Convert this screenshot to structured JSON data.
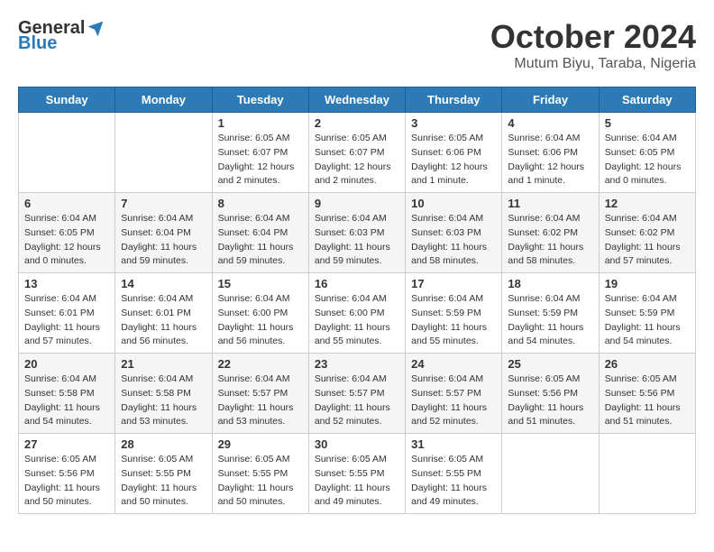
{
  "logo": {
    "general": "General",
    "blue": "Blue"
  },
  "title": "October 2024",
  "subtitle": "Mutum Biyu, Taraba, Nigeria",
  "days_of_week": [
    "Sunday",
    "Monday",
    "Tuesday",
    "Wednesday",
    "Thursday",
    "Friday",
    "Saturday"
  ],
  "weeks": [
    [
      {
        "day": "",
        "info": ""
      },
      {
        "day": "",
        "info": ""
      },
      {
        "day": "1",
        "info": "Sunrise: 6:05 AM\nSunset: 6:07 PM\nDaylight: 12 hours and 2 minutes."
      },
      {
        "day": "2",
        "info": "Sunrise: 6:05 AM\nSunset: 6:07 PM\nDaylight: 12 hours and 2 minutes."
      },
      {
        "day": "3",
        "info": "Sunrise: 6:05 AM\nSunset: 6:06 PM\nDaylight: 12 hours and 1 minute."
      },
      {
        "day": "4",
        "info": "Sunrise: 6:04 AM\nSunset: 6:06 PM\nDaylight: 12 hours and 1 minute."
      },
      {
        "day": "5",
        "info": "Sunrise: 6:04 AM\nSunset: 6:05 PM\nDaylight: 12 hours and 0 minutes."
      }
    ],
    [
      {
        "day": "6",
        "info": "Sunrise: 6:04 AM\nSunset: 6:05 PM\nDaylight: 12 hours and 0 minutes."
      },
      {
        "day": "7",
        "info": "Sunrise: 6:04 AM\nSunset: 6:04 PM\nDaylight: 11 hours and 59 minutes."
      },
      {
        "day": "8",
        "info": "Sunrise: 6:04 AM\nSunset: 6:04 PM\nDaylight: 11 hours and 59 minutes."
      },
      {
        "day": "9",
        "info": "Sunrise: 6:04 AM\nSunset: 6:03 PM\nDaylight: 11 hours and 59 minutes."
      },
      {
        "day": "10",
        "info": "Sunrise: 6:04 AM\nSunset: 6:03 PM\nDaylight: 11 hours and 58 minutes."
      },
      {
        "day": "11",
        "info": "Sunrise: 6:04 AM\nSunset: 6:02 PM\nDaylight: 11 hours and 58 minutes."
      },
      {
        "day": "12",
        "info": "Sunrise: 6:04 AM\nSunset: 6:02 PM\nDaylight: 11 hours and 57 minutes."
      }
    ],
    [
      {
        "day": "13",
        "info": "Sunrise: 6:04 AM\nSunset: 6:01 PM\nDaylight: 11 hours and 57 minutes."
      },
      {
        "day": "14",
        "info": "Sunrise: 6:04 AM\nSunset: 6:01 PM\nDaylight: 11 hours and 56 minutes."
      },
      {
        "day": "15",
        "info": "Sunrise: 6:04 AM\nSunset: 6:00 PM\nDaylight: 11 hours and 56 minutes."
      },
      {
        "day": "16",
        "info": "Sunrise: 6:04 AM\nSunset: 6:00 PM\nDaylight: 11 hours and 55 minutes."
      },
      {
        "day": "17",
        "info": "Sunrise: 6:04 AM\nSunset: 5:59 PM\nDaylight: 11 hours and 55 minutes."
      },
      {
        "day": "18",
        "info": "Sunrise: 6:04 AM\nSunset: 5:59 PM\nDaylight: 11 hours and 54 minutes."
      },
      {
        "day": "19",
        "info": "Sunrise: 6:04 AM\nSunset: 5:59 PM\nDaylight: 11 hours and 54 minutes."
      }
    ],
    [
      {
        "day": "20",
        "info": "Sunrise: 6:04 AM\nSunset: 5:58 PM\nDaylight: 11 hours and 54 minutes."
      },
      {
        "day": "21",
        "info": "Sunrise: 6:04 AM\nSunset: 5:58 PM\nDaylight: 11 hours and 53 minutes."
      },
      {
        "day": "22",
        "info": "Sunrise: 6:04 AM\nSunset: 5:57 PM\nDaylight: 11 hours and 53 minutes."
      },
      {
        "day": "23",
        "info": "Sunrise: 6:04 AM\nSunset: 5:57 PM\nDaylight: 11 hours and 52 minutes."
      },
      {
        "day": "24",
        "info": "Sunrise: 6:04 AM\nSunset: 5:57 PM\nDaylight: 11 hours and 52 minutes."
      },
      {
        "day": "25",
        "info": "Sunrise: 6:05 AM\nSunset: 5:56 PM\nDaylight: 11 hours and 51 minutes."
      },
      {
        "day": "26",
        "info": "Sunrise: 6:05 AM\nSunset: 5:56 PM\nDaylight: 11 hours and 51 minutes."
      }
    ],
    [
      {
        "day": "27",
        "info": "Sunrise: 6:05 AM\nSunset: 5:56 PM\nDaylight: 11 hours and 50 minutes."
      },
      {
        "day": "28",
        "info": "Sunrise: 6:05 AM\nSunset: 5:55 PM\nDaylight: 11 hours and 50 minutes."
      },
      {
        "day": "29",
        "info": "Sunrise: 6:05 AM\nSunset: 5:55 PM\nDaylight: 11 hours and 50 minutes."
      },
      {
        "day": "30",
        "info": "Sunrise: 6:05 AM\nSunset: 5:55 PM\nDaylight: 11 hours and 49 minutes."
      },
      {
        "day": "31",
        "info": "Sunrise: 6:05 AM\nSunset: 5:55 PM\nDaylight: 11 hours and 49 minutes."
      },
      {
        "day": "",
        "info": ""
      },
      {
        "day": "",
        "info": ""
      }
    ]
  ]
}
